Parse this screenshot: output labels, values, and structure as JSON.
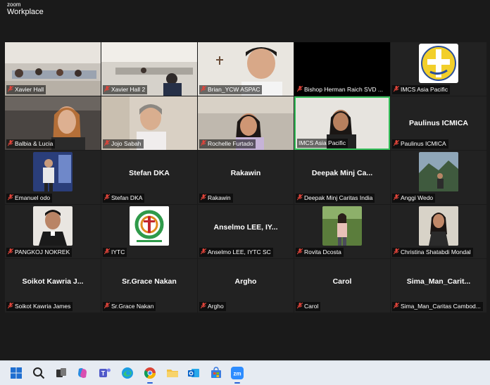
{
  "app": {
    "logo_top": "zoom",
    "logo_bottom": "Workplace"
  },
  "tiles": [
    {
      "label": "Xavier Hall",
      "name": ""
    },
    {
      "label": "Xavier Hall 2",
      "name": ""
    },
    {
      "label": "Brian_YCW ASPAC",
      "name": ""
    },
    {
      "label": "Bishop Herman Raich SVD ...",
      "name": ""
    },
    {
      "label": "IMCS Asia Pacific",
      "name": ""
    },
    {
      "label": "Balbia & Lucia",
      "name": ""
    },
    {
      "label": "Jojo Sabah",
      "name": ""
    },
    {
      "label": "Rochelle Furtado",
      "name": ""
    },
    {
      "label": "IMCS Asia Pacific",
      "name": ""
    },
    {
      "label": "Paulinus ICMICA",
      "name": "Paulinus ICMICA"
    },
    {
      "label": "Emanuel odo",
      "name": ""
    },
    {
      "label": "Stefan DKA",
      "name": "Stefan DKA"
    },
    {
      "label": "Rakawin",
      "name": "Rakawin"
    },
    {
      "label": "Deepak Minj Caritas India",
      "name": "Deepak Minj Ca..."
    },
    {
      "label": "Anggi Wedo",
      "name": ""
    },
    {
      "label": "PANGKOJ NOKREK",
      "name": ""
    },
    {
      "label": "IYTC",
      "name": ""
    },
    {
      "label": "Anselmo LEE, IYTC SC",
      "name": "Anselmo LEE, IY..."
    },
    {
      "label": "Rovita Dcosta",
      "name": ""
    },
    {
      "label": "Christina Shatabdi Mondal",
      "name": ""
    },
    {
      "label": "Soikot Kawria James",
      "name": "Soikot  Kawria  J..."
    },
    {
      "label": "Sr.Grace Nakan",
      "name": "Sr.Grace Nakan"
    },
    {
      "label": "Argho",
      "name": "Argho"
    },
    {
      "label": "Carol",
      "name": "Carol"
    },
    {
      "label": "Sima_Man_Caritas Cambod...",
      "name": "Sima_Man_Carit..."
    }
  ],
  "icons": {
    "muted": "mic-muted-icon"
  },
  "colors": {
    "active_speaker": "#35c05a",
    "muted": "#e0443a",
    "tile_bg": "#222222"
  }
}
